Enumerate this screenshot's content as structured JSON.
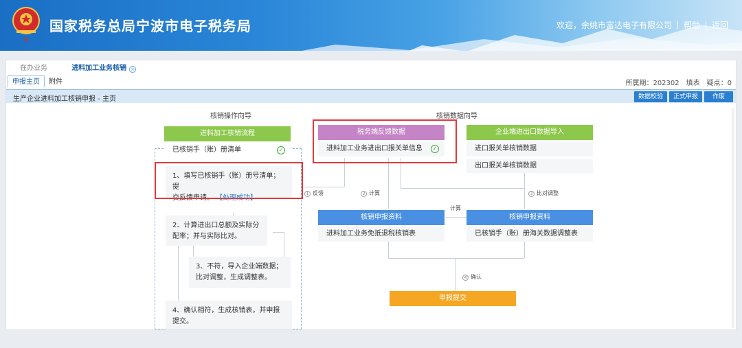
{
  "header": {
    "title": "国家税务总局宁波市电子税务局",
    "welcome": "欢迎，余姚市富达电子有限公司",
    "help": "帮助",
    "back": "返回"
  },
  "tabs": {
    "t1": "在办业务",
    "t2": "进料加工业务核销"
  },
  "subtabs": {
    "main": "申报主页",
    "attach": "附件"
  },
  "period": "所属期：202302　填表　疑点：0",
  "titlebar": {
    "text": "生产企业进料加工核销申报 - 主页",
    "btn_check": "数据校验",
    "btn_submit": "正式申报",
    "btn_void": "作废"
  },
  "flow": {
    "left_header": "核销操作向导",
    "right_header": "核销数据向导",
    "left_box_title": "进料加工核销流程",
    "left_box_row": "已核销手（账）册清单",
    "step1_a": "1、填写已核销手（账）册号清单；提",
    "step1_b": "交反馈申请。",
    "step1_ok": "【处理成功】",
    "step2_a": "2、计算进出口总额及实际分",
    "step2_b": "配率；并与实际比对。",
    "step3_a": "3、不符，导入企业端数据；",
    "step3_b": "比对调整，生成调整表。",
    "step4_a": "4、确认相符，生成核销表，并申报",
    "step4_b": "提交。",
    "tax_box_title": "税务端反馈数据",
    "tax_box_row": "进料加工业务进出口报关单信息",
    "ent_box_title": "企业端进出口数据导入",
    "ent_row1": "进口报关单核销数据",
    "ent_row2": "出口报关单核销数据",
    "decl1_title": "核销申报资料",
    "decl1_row": "进料加工业务免抵退税核销表",
    "decl2_title": "核销申报资料",
    "decl2_row": "已核销手（账）册海关数据调整表",
    "submit": "申报提交",
    "lbl_feedback_n": "1",
    "lbl_feedback": "反馈",
    "lbl_calc_n": "2",
    "lbl_calc": "计算",
    "lbl_calc2": "计算",
    "lbl_adjust_n": "3",
    "lbl_adjust": "比对调整",
    "lbl_confirm_n": "4",
    "lbl_confirm": "确认"
  }
}
